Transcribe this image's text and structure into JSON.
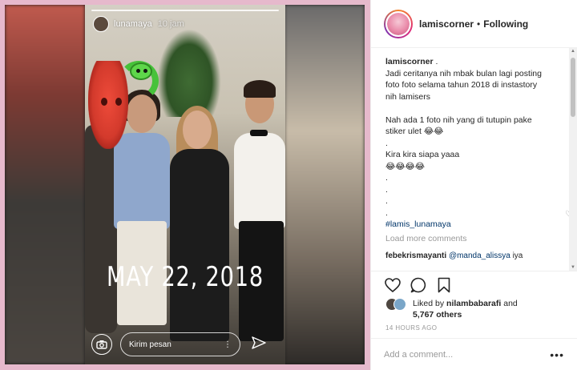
{
  "story": {
    "username": "lunamaya",
    "time": "10 jam",
    "date_overlay": "MAY 22, 2018",
    "message_placeholder": "Kirim pesan"
  },
  "post": {
    "header": {
      "username": "lamiscorner",
      "separator": "•",
      "follow_status": "Following"
    },
    "caption": {
      "username": "lamiscorner",
      "username_suffix": " .",
      "lines": [
        "Jadi ceritanya nih mbak bulan lagi posting",
        "foto foto selama tahun 2018 di instastory",
        "nih lamisers",
        "",
        "Nah ada 1 foto nih yang di tutupin pake",
        "stiker ulet 😂😂",
        ".",
        "Kira kira siapa yaaa",
        "😂😂😂😂",
        ".",
        ".",
        ".",
        "."
      ],
      "hashtag": "#lamis_lunamaya"
    },
    "load_more": "Load more comments",
    "comment": {
      "username": "febekrismayanti",
      "mention": "@manda_alissya",
      "text": " iya"
    },
    "likes": {
      "prefix": "Liked by ",
      "user": "nilambabarafi",
      "conjunction": " and",
      "count": "5,767 others"
    },
    "timestamp": "14 HOURS AGO",
    "add_comment_placeholder": "Add a comment...",
    "more_label": "•••"
  },
  "colors": {
    "frame": "#e6b9cc",
    "link": "#003569",
    "muted": "#999999",
    "text": "#262626"
  }
}
